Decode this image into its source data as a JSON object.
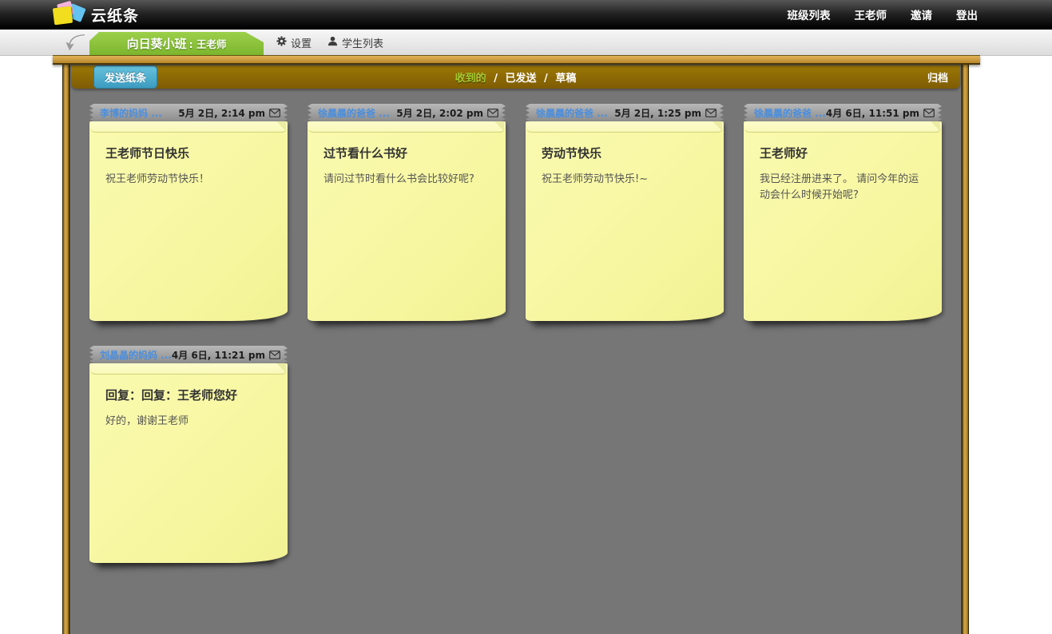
{
  "header": {
    "app_title": "云纸条",
    "nav": [
      {
        "label": "班级列表"
      },
      {
        "label": "王老师"
      },
      {
        "label": "邀请"
      },
      {
        "label": "登出"
      }
    ]
  },
  "tabbar": {
    "class_name": "向日葵小班",
    "teacher_suffix": ": 王老师",
    "settings_label": "设置",
    "students_label": "学生列表"
  },
  "toolbar": {
    "send_button": "发送纸条",
    "filter_received": "收到的",
    "separator": "/",
    "filter_sent": "已发送",
    "filter_draft": "草稿",
    "archive_label": "归档"
  },
  "notes": [
    {
      "sender": "李博的妈妈 ...",
      "date": "5月 2日, 2:14 pm",
      "title": "王老师节日快乐",
      "body": "祝王老师劳动节快乐！"
    },
    {
      "sender": "徐晨晨的爸爸 ...",
      "date": "5月 2日, 2:02 pm",
      "title": "过节看什么书好",
      "body": "请问过节时看什么书会比较好呢?"
    },
    {
      "sender": "徐晨晨的爸爸 ...",
      "date": "5月 2日, 1:25 pm",
      "title": "劳动节快乐",
      "body": "祝王老师劳动节快乐!~"
    },
    {
      "sender": "徐晨晨的爸爸 ...",
      "date": "4月 6日, 11:51 pm",
      "title": "王老师好",
      "body": "我已经注册进来了。 请问今年的运动会什么时候开始呢?"
    },
    {
      "sender": "刘晶晶的妈妈 ...",
      "date": "4月 6日, 11:21 pm",
      "title": "回复：回复：王老师您好",
      "body": "好的，谢谢王老师"
    }
  ],
  "icons": {
    "logo": "sticky-notes-logo",
    "back": "back-arrow-icon",
    "settings": "gear-icon",
    "students": "person-icon",
    "envelope": "envelope-icon"
  },
  "colors": {
    "tab_green": "#8dc63f",
    "toolbar_brown": "#8a6505",
    "button_blue": "#45a5c6",
    "note_yellow": "#f7f7a2",
    "board_gray": "#767676",
    "frame_wood": "#c6953a",
    "link_blue": "#4a8ede",
    "filter_green": "#a3cb33"
  }
}
